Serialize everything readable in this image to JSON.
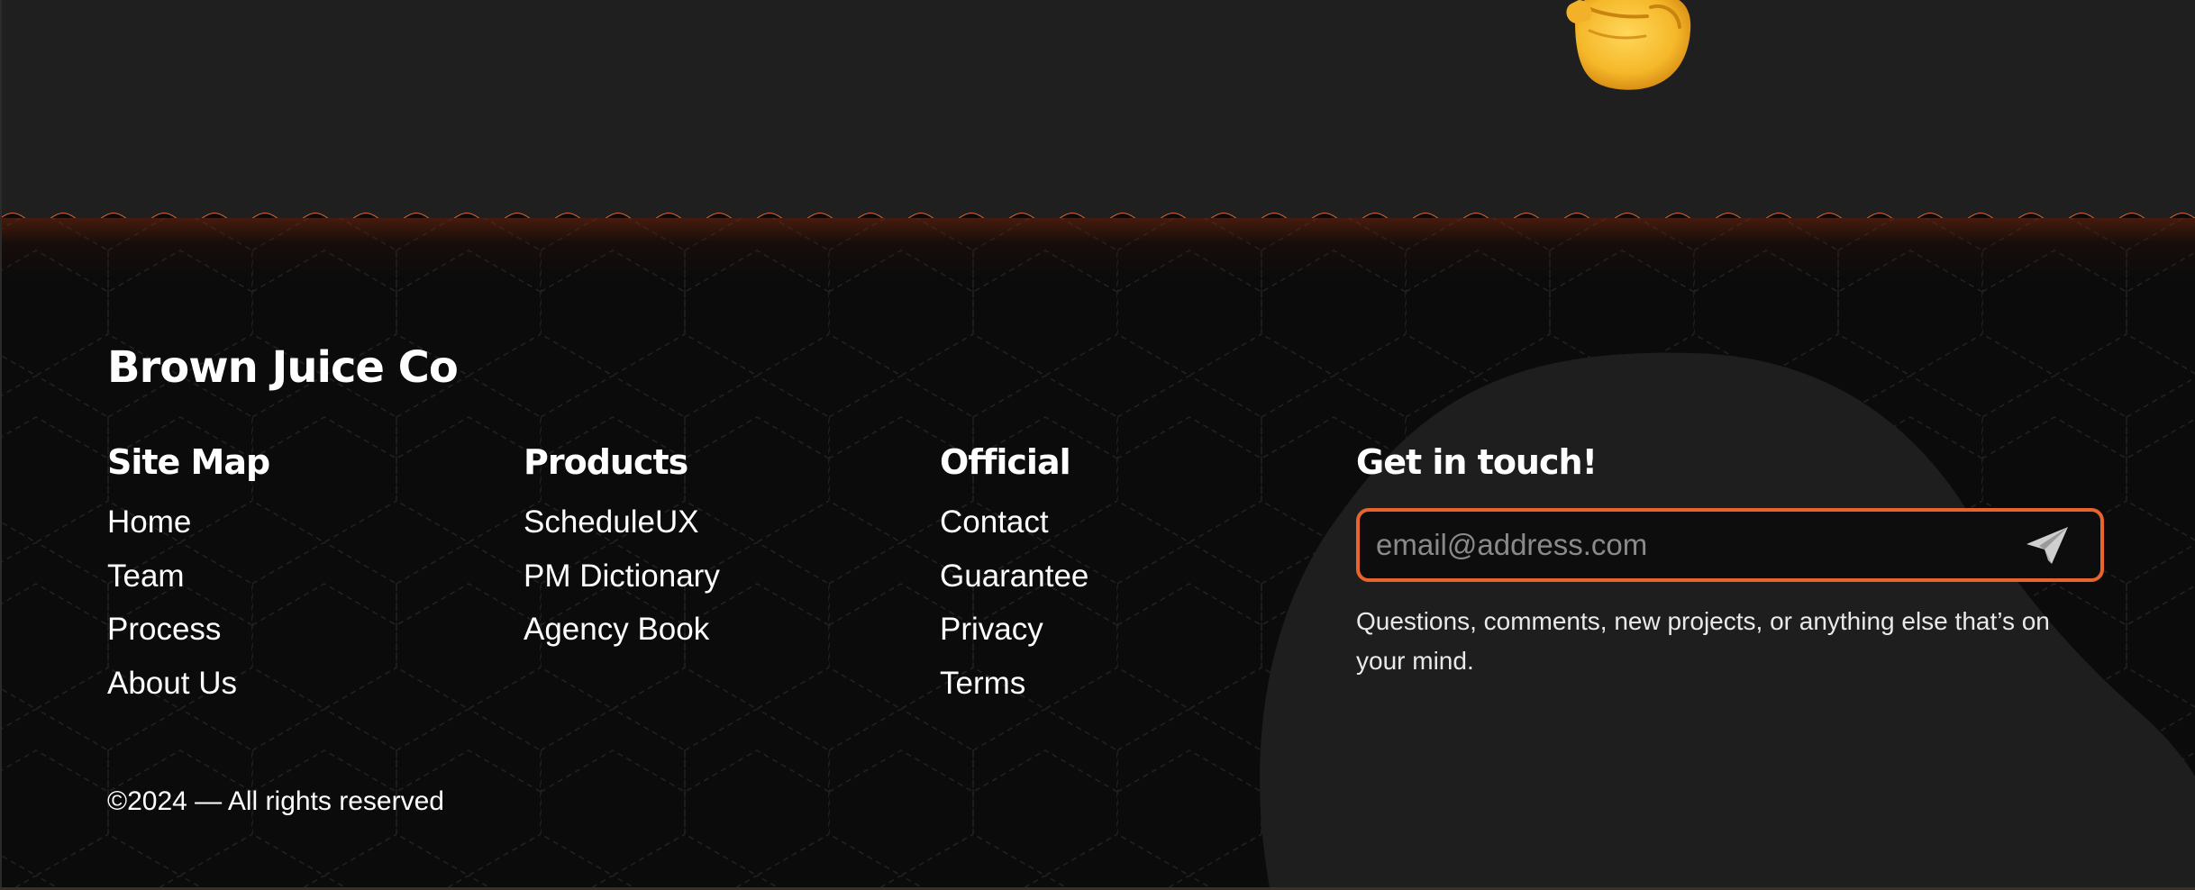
{
  "colors": {
    "accent": "#e8642f",
    "top_band": "#1f1f1f",
    "footer_bg": "#0b0b0b",
    "blob": "#1e1e1e",
    "text": "#ffffff",
    "placeholder": "#8a8a8a"
  },
  "hero": {
    "emoji_icon": "raised-fist-emoji"
  },
  "footer": {
    "brand": "Brown Juice Co",
    "sitemap": {
      "heading": "Site Map",
      "links": [
        "Home",
        "Team",
        "Process",
        "About Us"
      ]
    },
    "products": {
      "heading": "Products",
      "links": [
        "ScheduleUX",
        "PM Dictionary",
        "Agency Book"
      ]
    },
    "official": {
      "heading": "Official",
      "links": [
        "Contact",
        "Guarantee",
        "Privacy",
        "Terms"
      ]
    },
    "contact": {
      "heading": "Get in touch!",
      "email_placeholder": "email@address.com",
      "send_icon": "paper-plane-icon",
      "note": "Questions, comments, new projects, or anything else that’s on your mind."
    },
    "copyright": "©2024 — All rights reserved"
  }
}
